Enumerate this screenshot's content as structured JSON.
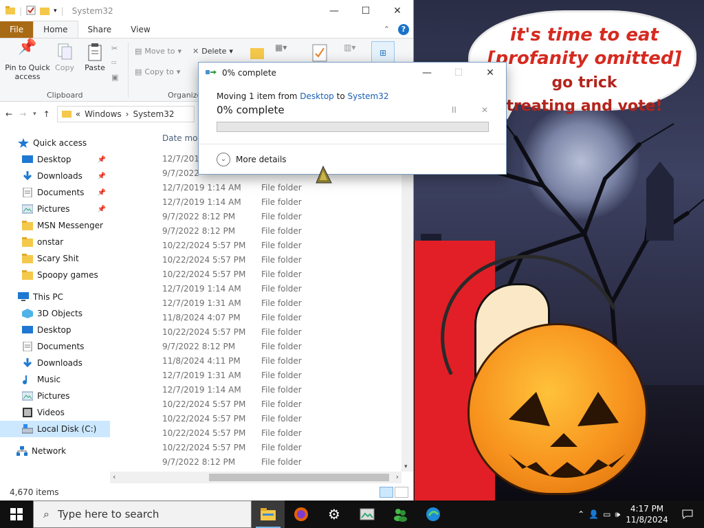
{
  "wallpaper": {
    "caption_line1": "it's time to eat [profanity omitted]",
    "caption_line2_em": "",
    "caption_line2_rest": "go trick",
    "caption_line3": "treating and vote!"
  },
  "explorer": {
    "title": "System32",
    "window_controls": {
      "minimize": "—",
      "maximize": "☐",
      "close": "✕"
    },
    "tabs": [
      "File",
      "Home",
      "Share",
      "View"
    ],
    "ribbon": {
      "pin_label": "Pin to Quick access",
      "copy_label": "Copy",
      "paste_label": "Paste",
      "move_to": "Move to",
      "delete": "Delete",
      "copy_to": "Copy to",
      "group_clipboard": "Clipboard",
      "group_organize": "Organize"
    },
    "address": {
      "root": "Windows",
      "current": "System32",
      "sep": "«",
      "sep2": "›"
    },
    "nav": {
      "quick_access": "Quick access",
      "qa_items": [
        {
          "label": "Desktop",
          "pinned": true,
          "icon": "desktop-icon"
        },
        {
          "label": "Downloads",
          "pinned": true,
          "icon": "downloads-icon"
        },
        {
          "label": "Documents",
          "pinned": true,
          "icon": "documents-icon"
        },
        {
          "label": "Pictures",
          "pinned": true,
          "icon": "pictures-icon"
        },
        {
          "label": "MSN Messenger",
          "pinned": false,
          "icon": "folder-icon"
        },
        {
          "label": "onstar",
          "pinned": false,
          "icon": "folder-icon"
        },
        {
          "label": "Scary Shit",
          "pinned": false,
          "icon": "folder-icon"
        },
        {
          "label": "Spoopy games",
          "pinned": false,
          "icon": "folder-icon"
        }
      ],
      "this_pc": "This PC",
      "pc_items": [
        {
          "label": "3D Objects",
          "icon": "3d-objects-icon"
        },
        {
          "label": "Desktop",
          "icon": "desktop-icon"
        },
        {
          "label": "Documents",
          "icon": "documents-icon"
        },
        {
          "label": "Downloads",
          "icon": "downloads-icon"
        },
        {
          "label": "Music",
          "icon": "music-icon"
        },
        {
          "label": "Pictures",
          "icon": "pictures-icon"
        },
        {
          "label": "Videos",
          "icon": "videos-icon"
        },
        {
          "label": "Local Disk (C:)",
          "icon": "drive-icon",
          "selected": true
        }
      ],
      "network": "Network"
    },
    "list": {
      "header_date": "Date mod",
      "rows": [
        {
          "date": "12/7/2019",
          "type": ""
        },
        {
          "date": "9/7/2022",
          "type": ""
        },
        {
          "date": "12/7/2019 1:14 AM",
          "type": "File folder"
        },
        {
          "date": "12/7/2019 1:14 AM",
          "type": "File folder"
        },
        {
          "date": "9/7/2022 8:12 PM",
          "type": "File folder"
        },
        {
          "date": "9/7/2022 8:12 PM",
          "type": "File folder"
        },
        {
          "date": "10/22/2024 5:57 PM",
          "type": "File folder"
        },
        {
          "date": "10/22/2024 5:57 PM",
          "type": "File folder"
        },
        {
          "date": "10/22/2024 5:57 PM",
          "type": "File folder"
        },
        {
          "date": "12/7/2019 1:14 AM",
          "type": "File folder"
        },
        {
          "date": "12/7/2019 1:31 AM",
          "type": "File folder"
        },
        {
          "date": "11/8/2024 4:07 PM",
          "type": "File folder"
        },
        {
          "date": "10/22/2024 5:57 PM",
          "type": "File folder"
        },
        {
          "date": "9/7/2022 8:12 PM",
          "type": "File folder"
        },
        {
          "date": "11/8/2024 4:11 PM",
          "type": "File folder"
        },
        {
          "date": "12/7/2019 1:31 AM",
          "type": "File folder"
        },
        {
          "date": "12/7/2019 1:14 AM",
          "type": "File folder"
        },
        {
          "date": "10/22/2024 5:57 PM",
          "type": "File folder"
        },
        {
          "date": "10/22/2024 5:57 PM",
          "type": "File folder"
        },
        {
          "date": "10/22/2024 5:57 PM",
          "type": "File folder"
        },
        {
          "date": "10/22/2024 5:57 PM",
          "type": "File folder"
        },
        {
          "date": "9/7/2022 8:12 PM",
          "type": "File folder"
        }
      ]
    },
    "status": "4,670 items"
  },
  "dialog": {
    "title": "0% complete",
    "line_prefix": "Moving 1 item from ",
    "from": "Desktop",
    "to_word": " to ",
    "to": "System32",
    "percent_text": "0% complete",
    "progress": 0,
    "pause": "II",
    "cancel": "✕",
    "more_details": "More details"
  },
  "taskbar": {
    "search_placeholder": "Type here to search",
    "time": "4:17 PM",
    "date": "11/8/2024",
    "apps": [
      "file-explorer-icon",
      "firefox-icon",
      "settings-icon",
      "photo-viewer-icon",
      "msn-messenger-icon",
      "edge-icon"
    ]
  },
  "colors": {
    "file_tab": "#a86a14",
    "accent": "#0078d7",
    "link": "#1a5fb4",
    "progress": "#06b025"
  }
}
